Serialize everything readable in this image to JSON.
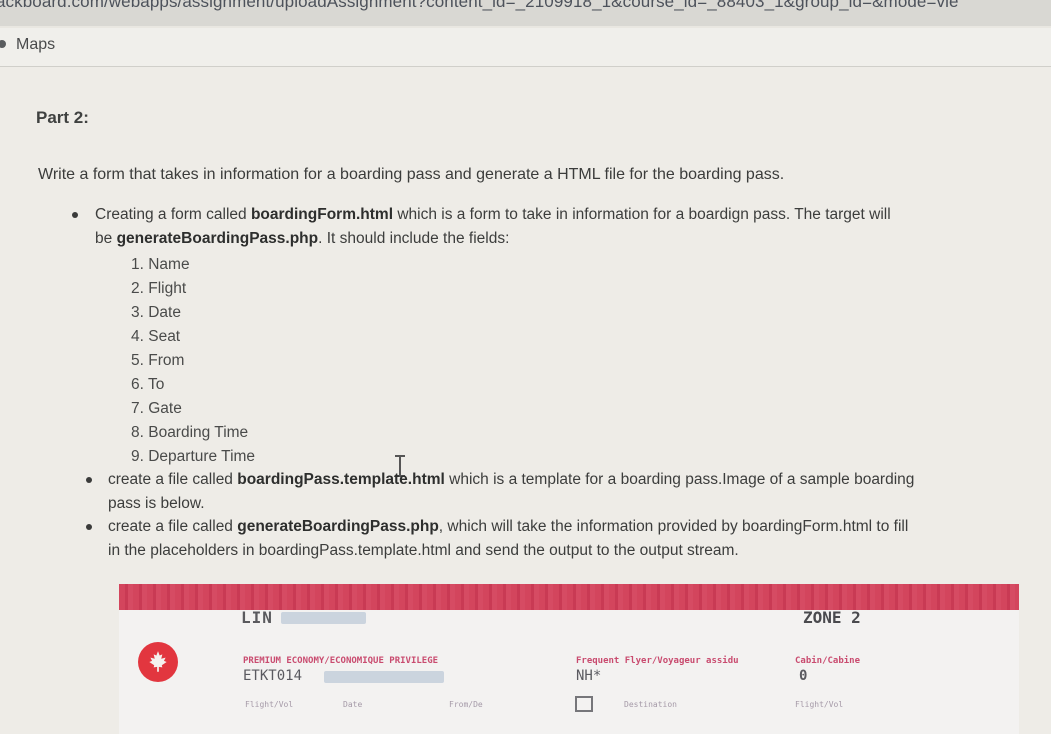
{
  "browser": {
    "url": "ackboard.com/webapps/assignment/uploadAssignment?content_id=_2109918_1&course_id=_88403_1&group_id=&mode=vie",
    "bookmark_label": "Maps"
  },
  "assignment": {
    "heading": "Part 2:",
    "intro": "Write a form that takes in information for a boarding pass and generate a HTML file for the boarding pass.",
    "bullet1": {
      "pre": "Creating a form called ",
      "file": "boardingForm.html",
      "mid": " which is a form to take in information for a boardign pass. The target will",
      "line2_pre": "be ",
      "target": "generateBoardingPass.php",
      "line2_post": ". It should include the fields:"
    },
    "fields": [
      "1. Name",
      "2. Flight",
      "3. Date",
      "4. Seat",
      "5. From",
      "6. To",
      "7. Gate",
      "8. Boarding Time",
      "9. Departure Time"
    ],
    "bullet2": {
      "pre": "create a file called ",
      "file": "boardingPass.template.html",
      "post": " which is a template for a boarding pass.Image of a sample boarding",
      "line2": "pass is below."
    },
    "bullet3": {
      "pre": "create a file called ",
      "file": "generateBoardingPass.php",
      "post": ", which will take the information provided by boardingForm.html to fill",
      "line2": "in the placeholders in boardingPass.template.html and send the output to the output stream."
    }
  },
  "boarding_pass": {
    "name": "LIN",
    "zone": "ZONE 2",
    "class_label": "PREMIUM ECONOMY/ECONOMIQUE PRIVILEGE",
    "ticket": "ETKT014",
    "frequent_flyer_label": "Frequent Flyer/Voyageur assidu",
    "frequent_flyer_value": "NH*",
    "cabin_label": "Cabin/Cabine",
    "cabin_value": "0",
    "footer": [
      "Flight/Vol",
      "Date",
      "From/De",
      "Destination",
      "Flight/Vol"
    ],
    "brand_colors": {
      "band": "#d3455d",
      "logo": "#e2363f"
    },
    "logo_icon": "maple-leaf-icon"
  }
}
